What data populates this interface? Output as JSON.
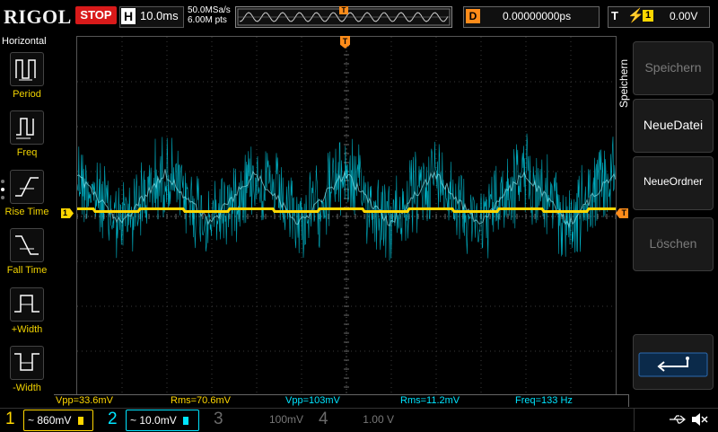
{
  "header": {
    "brand": "RIGOL",
    "run_state": "STOP",
    "timebase_letter": "H",
    "timebase_value": "10.0ms",
    "sample_rate": "50.0MSa/s",
    "memory_depth": "6.00M pts",
    "trigger_marker": "T",
    "delay_letter": "D",
    "delay_value": "0.00000000ps",
    "trigger_letter": "T",
    "trigger_slope_icon": "rising-edge-icon",
    "trigger_channel": "1",
    "trigger_level": "0.00V"
  },
  "left_menu": {
    "title": "Horizontal",
    "items": [
      {
        "label": "Period",
        "icon": "period-icon"
      },
      {
        "label": "Freq",
        "icon": "frequency-icon"
      },
      {
        "label": "Rise Time",
        "icon": "rise-time-icon"
      },
      {
        "label": "Fall Time",
        "icon": "fall-time-icon"
      },
      {
        "label": "+Width",
        "icon": "positive-width-icon"
      },
      {
        "label": "-Width",
        "icon": "negative-width-icon"
      }
    ]
  },
  "right_menu": {
    "title": "Speichern",
    "buttons": [
      {
        "label": "Speichern",
        "enabled": false
      },
      {
        "label": "NeueDatei",
        "enabled": true
      },
      {
        "label": "NeueOrdner",
        "enabled": true
      },
      {
        "label": "Löschen",
        "enabled": false
      },
      {
        "label": "",
        "icon": "return-icon",
        "enabled": true
      }
    ]
  },
  "markers": {
    "ch1_ground": "1",
    "trigger_position": "T"
  },
  "measurements": [
    {
      "text": "Vpp=33.6mV",
      "color": "#ffd700"
    },
    {
      "text": "Rms=70.6mV",
      "color": "#ffd700"
    },
    {
      "text": "Vpp=103mV",
      "color": "#00e5ff"
    },
    {
      "text": "Rms=11.2mV",
      "color": "#00e5ff"
    },
    {
      "text": "Freq=133 Hz",
      "color": "#00e5ff"
    }
  ],
  "channels": [
    {
      "num": "1",
      "coupling": "~",
      "scale": "860mV",
      "color": "#ffd700",
      "active": true
    },
    {
      "num": "2",
      "coupling": "~",
      "scale": "10.0mV",
      "color": "#00e5ff",
      "active": true
    },
    {
      "num": "3",
      "coupling": "",
      "scale": "100mV",
      "color": "#777777",
      "active": false
    },
    {
      "num": "4",
      "coupling": "",
      "scale": "1.00 V",
      "color": "#777777",
      "active": false
    }
  ],
  "status": {
    "usb_icon": "usb-icon",
    "sound_icon": "speaker-muted-icon"
  },
  "colors": {
    "ch1": "#ffd700",
    "ch2": "#00e5ff",
    "trigger": "#ff8c1a",
    "stop": "#d81a1a"
  }
}
